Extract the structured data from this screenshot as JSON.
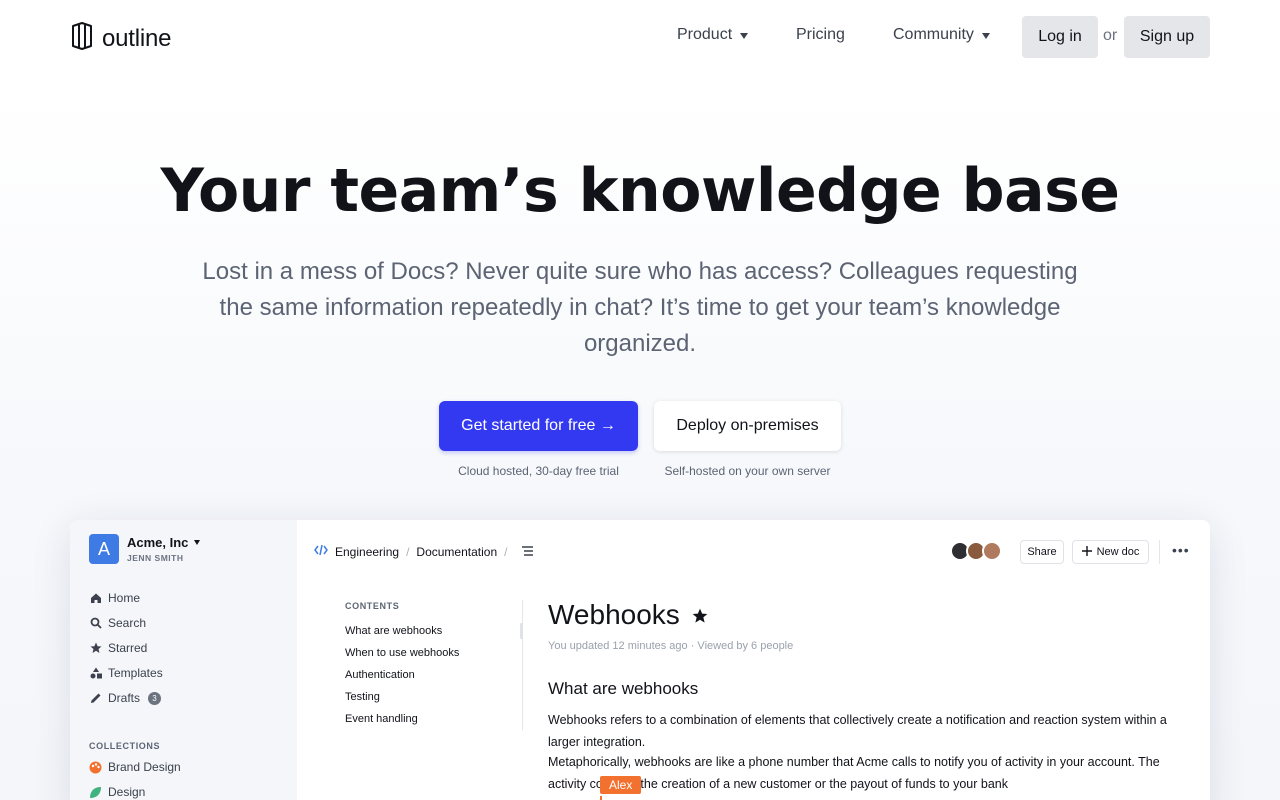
{
  "nav": {
    "logo_text": "outline",
    "items": [
      {
        "label": "Product",
        "dropdown": true
      },
      {
        "label": "Pricing",
        "dropdown": false
      },
      {
        "label": "Community",
        "dropdown": true
      }
    ],
    "login_label": "Log in",
    "or_label": "or",
    "signup_label": "Sign up"
  },
  "hero": {
    "title": "Your team’s knowledge base",
    "subtitle": "Lost in a mess of Docs? Never quite sure who has access? Colleagues requesting the same information repeatedly in chat? It’s time to get your team’s knowledge organized.",
    "cta_primary": "Get started for free →",
    "cta_primary_note": "Cloud hosted, 30-day free trial",
    "cta_secondary": "Deploy on-premises",
    "cta_secondary_note": "Self-hosted on your own server"
  },
  "app": {
    "team": {
      "avatar_letter": "A",
      "name": "Acme, Inc",
      "user": "JENN SMITH"
    },
    "sidebar": {
      "items": [
        {
          "label": "Home",
          "icon": "home-icon"
        },
        {
          "label": "Search",
          "icon": "search-icon"
        },
        {
          "label": "Starred",
          "icon": "star-icon"
        },
        {
          "label": "Templates",
          "icon": "shapes-icon"
        },
        {
          "label": "Drafts",
          "icon": "pencil-icon",
          "badge": "3"
        }
      ],
      "collections_heading": "COLLECTIONS",
      "collections": [
        {
          "label": "Brand Design",
          "color": "#f2712e"
        },
        {
          "label": "Design",
          "color": "#3fb27f"
        }
      ]
    },
    "breadcrumb": {
      "collection": "Engineering",
      "doc": "Documentation"
    },
    "toolbar": {
      "share_label": "Share",
      "new_doc_label": "New doc"
    },
    "toc": {
      "heading": "CONTENTS",
      "items": [
        "What are webhooks",
        "When to use webhooks",
        "Authentication",
        "Testing",
        "Event handling"
      ]
    },
    "doc": {
      "title": "Webhooks",
      "meta": "You updated 12 minutes ago · Viewed by 6 people",
      "h2": "What are webhooks",
      "p1": "Webhooks refers to a combination of elements that collectively create a notification and reaction system within a larger integration.",
      "p2": "Metaphorically, webhooks are like a phone number that Acme calls to notify you of activity in your account. The activity could be the creation of a new customer or the payout of funds to your bank",
      "cursor_user": "Alex"
    }
  },
  "colors": {
    "primary": "#3339f0",
    "cursor": "#f2712e",
    "team_avatar": "#3e7be4"
  }
}
